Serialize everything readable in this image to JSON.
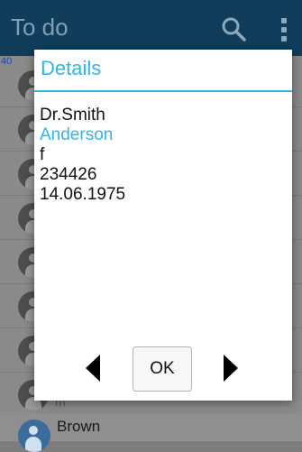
{
  "app": {
    "title": "To do",
    "count_label": "40",
    "partial_subtitle": "m",
    "bottom_item_name": "Brown",
    "colors": {
      "appbar": "#0f3d5b",
      "accent": "#33b5e5"
    }
  },
  "icons": {
    "search": "search-icon",
    "more": "more-vert-icon",
    "prev": "arrow-left-icon",
    "next": "arrow-right-icon",
    "avatar": "person-icon"
  },
  "dialog": {
    "title": "Details",
    "lines": [
      {
        "text": "Dr.Smith",
        "highlight": false
      },
      {
        "text": "Anderson",
        "highlight": true
      },
      {
        "text": "f",
        "highlight": false
      },
      {
        "text": "234426",
        "highlight": false
      },
      {
        "text": "14.06.1975",
        "highlight": false
      }
    ],
    "ok_label": "OK"
  }
}
